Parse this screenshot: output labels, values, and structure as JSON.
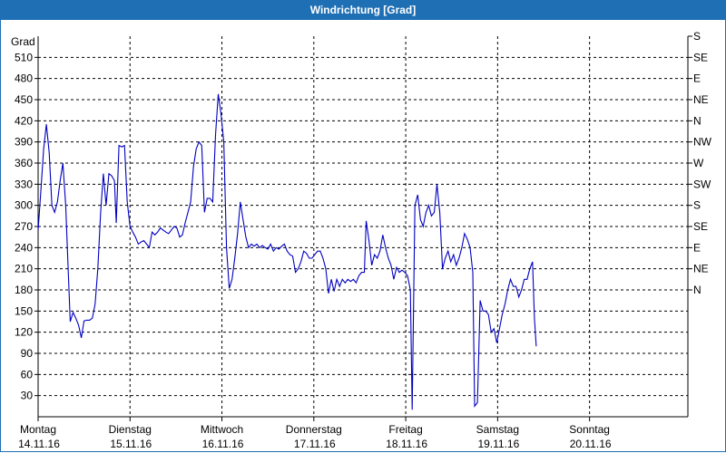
{
  "window": {
    "title": "Windrichtung [Grad]"
  },
  "chart_data": {
    "type": "line",
    "title": "Windrichtung [Grad]",
    "ylabel": "Grad",
    "ylim": [
      0,
      540
    ],
    "yticks": [
      30,
      60,
      90,
      120,
      150,
      180,
      210,
      240,
      270,
      300,
      330,
      360,
      390,
      420,
      450,
      480,
      510
    ],
    "right_ticks": [
      "S",
      "SE",
      "E",
      "NE",
      "N",
      "NW",
      "W",
      "SW",
      "S",
      "SE",
      "E",
      "NE",
      "N"
    ],
    "right_tick_values": [
      540,
      510,
      480,
      450,
      420,
      390,
      360,
      330,
      300,
      270,
      240,
      210,
      180
    ],
    "x_range": [
      0,
      7.07
    ],
    "days": [
      {
        "day": "Montag",
        "date": "14.11.16"
      },
      {
        "day": "Dienstag",
        "date": "15.11.16"
      },
      {
        "day": "Mittwoch",
        "date": "16.11.16"
      },
      {
        "day": "Donnerstag",
        "date": "17.11.16"
      },
      {
        "day": "Freitag",
        "date": "18.11.16"
      },
      {
        "day": "Samstag",
        "date": "19.11.16"
      },
      {
        "day": "Sonntag",
        "date": "20.11.16"
      }
    ],
    "grid": true,
    "series": [
      {
        "color": "#0000c0",
        "points": [
          [
            0.0,
            265
          ],
          [
            0.03,
            320
          ],
          [
            0.06,
            380
          ],
          [
            0.09,
            415
          ],
          [
            0.12,
            375
          ],
          [
            0.15,
            300
          ],
          [
            0.18,
            290
          ],
          [
            0.21,
            305
          ],
          [
            0.24,
            335
          ],
          [
            0.27,
            360
          ],
          [
            0.3,
            300
          ],
          [
            0.33,
            200
          ],
          [
            0.35,
            135
          ],
          [
            0.38,
            148
          ],
          [
            0.41,
            140
          ],
          [
            0.44,
            130
          ],
          [
            0.47,
            112
          ],
          [
            0.5,
            136
          ],
          [
            0.53,
            137
          ],
          [
            0.56,
            137
          ],
          [
            0.59,
            140
          ],
          [
            0.62,
            160
          ],
          [
            0.65,
            210
          ],
          [
            0.68,
            290
          ],
          [
            0.71,
            345
          ],
          [
            0.74,
            300
          ],
          [
            0.77,
            345
          ],
          [
            0.8,
            342
          ],
          [
            0.83,
            335
          ],
          [
            0.85,
            275
          ],
          [
            0.88,
            385
          ],
          [
            0.91,
            383
          ],
          [
            0.94,
            385
          ],
          [
            0.97,
            305
          ],
          [
            1.0,
            270
          ],
          [
            1.03,
            262
          ],
          [
            1.06,
            255
          ],
          [
            1.09,
            245
          ],
          [
            1.12,
            248
          ],
          [
            1.15,
            250
          ],
          [
            1.18,
            245
          ],
          [
            1.21,
            240
          ],
          [
            1.24,
            262
          ],
          [
            1.27,
            258
          ],
          [
            1.3,
            262
          ],
          [
            1.33,
            268
          ],
          [
            1.36,
            265
          ],
          [
            1.39,
            262
          ],
          [
            1.42,
            260
          ],
          [
            1.45,
            265
          ],
          [
            1.48,
            270
          ],
          [
            1.51,
            268
          ],
          [
            1.54,
            255
          ],
          [
            1.57,
            258
          ],
          [
            1.6,
            275
          ],
          [
            1.63,
            290
          ],
          [
            1.66,
            305
          ],
          [
            1.69,
            355
          ],
          [
            1.72,
            380
          ],
          [
            1.75,
            390
          ],
          [
            1.78,
            385
          ],
          [
            1.81,
            290
          ],
          [
            1.84,
            310
          ],
          [
            1.87,
            310
          ],
          [
            1.9,
            305
          ],
          [
            1.93,
            400
          ],
          [
            1.96,
            458
          ],
          [
            1.99,
            430
          ],
          [
            2.02,
            390
          ],
          [
            2.05,
            240
          ],
          [
            2.08,
            182
          ],
          [
            2.11,
            195
          ],
          [
            2.14,
            225
          ],
          [
            2.17,
            260
          ],
          [
            2.2,
            305
          ],
          [
            2.23,
            280
          ],
          [
            2.26,
            255
          ],
          [
            2.29,
            240
          ],
          [
            2.32,
            245
          ],
          [
            2.35,
            242
          ],
          [
            2.38,
            245
          ],
          [
            2.41,
            240
          ],
          [
            2.44,
            243
          ],
          [
            2.47,
            240
          ],
          [
            2.5,
            238
          ],
          [
            2.53,
            245
          ],
          [
            2.56,
            235
          ],
          [
            2.59,
            240
          ],
          [
            2.62,
            238
          ],
          [
            2.65,
            242
          ],
          [
            2.68,
            245
          ],
          [
            2.71,
            235
          ],
          [
            2.74,
            230
          ],
          [
            2.77,
            228
          ],
          [
            2.8,
            205
          ],
          [
            2.83,
            210
          ],
          [
            2.86,
            220
          ],
          [
            2.89,
            235
          ],
          [
            2.92,
            232
          ],
          [
            2.95,
            225
          ],
          [
            2.98,
            225
          ],
          [
            3.01,
            230
          ],
          [
            3.04,
            235
          ],
          [
            3.07,
            235
          ],
          [
            3.1,
            225
          ],
          [
            3.13,
            210
          ],
          [
            3.16,
            175
          ],
          [
            3.19,
            195
          ],
          [
            3.22,
            178
          ],
          [
            3.25,
            195
          ],
          [
            3.28,
            185
          ],
          [
            3.31,
            195
          ],
          [
            3.34,
            190
          ],
          [
            3.37,
            195
          ],
          [
            3.4,
            192
          ],
          [
            3.43,
            195
          ],
          [
            3.46,
            190
          ],
          [
            3.49,
            200
          ],
          [
            3.52,
            205
          ],
          [
            3.55,
            205
          ],
          [
            3.57,
            278
          ],
          [
            3.6,
            250
          ],
          [
            3.63,
            215
          ],
          [
            3.66,
            230
          ],
          [
            3.69,
            225
          ],
          [
            3.72,
            235
          ],
          [
            3.75,
            258
          ],
          [
            3.78,
            240
          ],
          [
            3.81,
            225
          ],
          [
            3.84,
            215
          ],
          [
            3.87,
            195
          ],
          [
            3.9,
            212
          ],
          [
            3.93,
            205
          ],
          [
            3.96,
            208
          ],
          [
            3.99,
            205
          ],
          [
            4.02,
            200
          ],
          [
            4.05,
            180
          ],
          [
            4.07,
            10
          ],
          [
            4.1,
            300
          ],
          [
            4.13,
            315
          ],
          [
            4.16,
            280
          ],
          [
            4.19,
            270
          ],
          [
            4.22,
            290
          ],
          [
            4.25,
            300
          ],
          [
            4.28,
            285
          ],
          [
            4.31,
            290
          ],
          [
            4.34,
            330
          ],
          [
            4.37,
            290
          ],
          [
            4.4,
            210
          ],
          [
            4.43,
            225
          ],
          [
            4.46,
            235
          ],
          [
            4.49,
            220
          ],
          [
            4.52,
            230
          ],
          [
            4.55,
            215
          ],
          [
            4.58,
            225
          ],
          [
            4.61,
            240
          ],
          [
            4.64,
            260
          ],
          [
            4.67,
            252
          ],
          [
            4.7,
            240
          ],
          [
            4.73,
            205
          ],
          [
            4.75,
            15
          ],
          [
            4.78,
            20
          ],
          [
            4.81,
            165
          ],
          [
            4.84,
            150
          ],
          [
            4.87,
            150
          ],
          [
            4.9,
            145
          ],
          [
            4.93,
            120
          ],
          [
            4.96,
            125
          ],
          [
            4.99,
            105
          ],
          [
            5.02,
            125
          ],
          [
            5.05,
            145
          ],
          [
            5.08,
            160
          ],
          [
            5.11,
            180
          ],
          [
            5.14,
            195
          ],
          [
            5.17,
            185
          ],
          [
            5.2,
            185
          ],
          [
            5.23,
            170
          ],
          [
            5.26,
            180
          ],
          [
            5.29,
            195
          ],
          [
            5.32,
            195
          ],
          [
            5.35,
            210
          ],
          [
            5.38,
            220
          ],
          [
            5.4,
            140
          ],
          [
            5.42,
            100
          ]
        ]
      }
    ]
  }
}
